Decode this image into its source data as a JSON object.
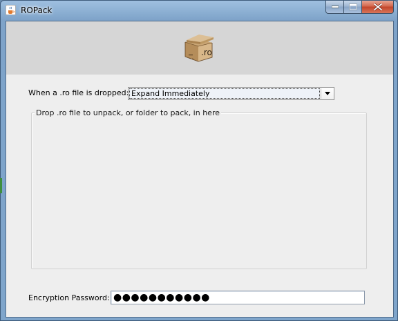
{
  "window": {
    "title": "ROPack",
    "icon": "java-coffee-icon"
  },
  "caption_buttons": {
    "minimize_icon": "minimize-icon",
    "maximize_icon": "maximize-icon",
    "close_icon": "close-icon"
  },
  "banner": {
    "logo_text": ".ro",
    "logo_icon": "package-box-icon"
  },
  "drop_action": {
    "label": "When a .ro file is dropped:",
    "selected": "Expand Immediately"
  },
  "drop_zone": {
    "title": "Drop .ro file to unpack, or folder to pack, in here"
  },
  "password": {
    "label": "Encryption Password:",
    "masked_value": "●●●●●●●●●●●"
  }
}
